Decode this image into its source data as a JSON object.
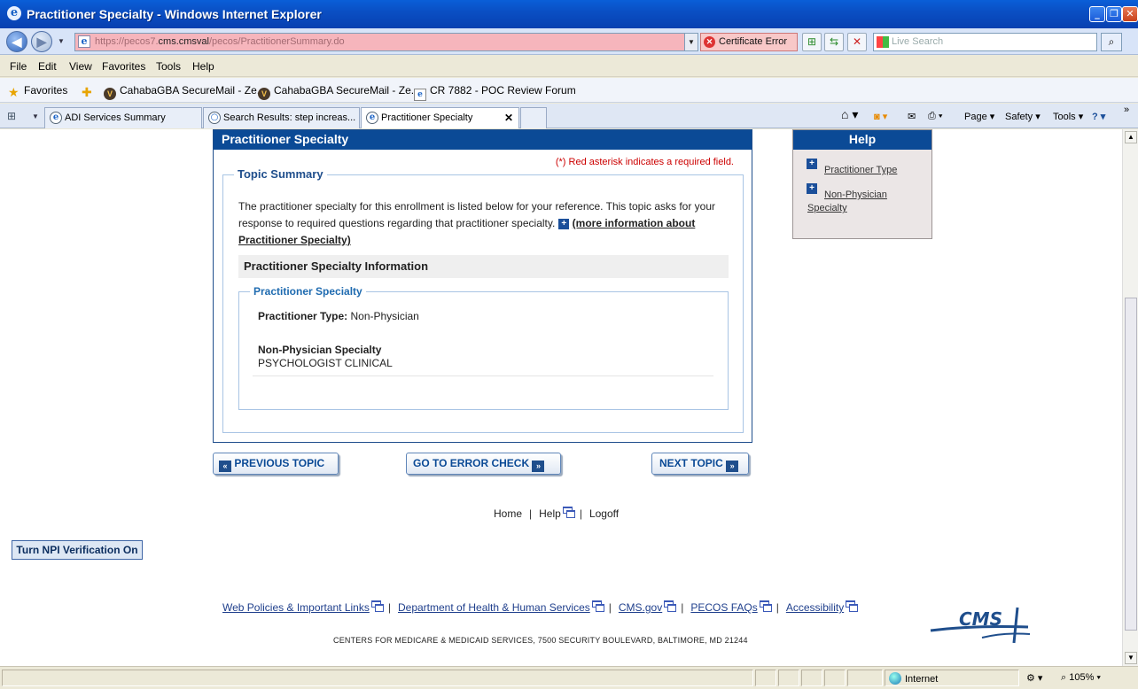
{
  "window": {
    "title": "Practitioner Specialty - Windows Internet Explorer"
  },
  "address_bar": {
    "url_prefix": "https://pecos7.",
    "url_host": "cms.cmsval",
    "url_suffix": "/pecos/PractitionerSummary.do",
    "cert_error": "Certificate Error",
    "search_placeholder": "Live Search"
  },
  "menu": [
    "File",
    "Edit",
    "View",
    "Favorites",
    "Tools",
    "Help"
  ],
  "favorites_bar": {
    "favorites_label": "Favorites",
    "items": [
      "CahabaGBA SecureMail - Ze...",
      "CahabaGBA SecureMail - Ze...",
      "CR 7882 - POC Review Forum"
    ]
  },
  "tabs": [
    {
      "label": "ADI Services Summary"
    },
    {
      "label": "Search Results: step increas..."
    },
    {
      "label": "Practitioner Specialty"
    }
  ],
  "command_bar": {
    "page": "Page",
    "safety": "Safety",
    "tools": "Tools"
  },
  "panel": {
    "title": "Practitioner Specialty",
    "required_note": "(*) Red asterisk indicates a required field.",
    "topic_summary_legend": "Topic Summary",
    "summary_text": "The practitioner specialty for this enrollment is listed below for your reference. This topic asks for your response to required questions regarding that practitioner specialty.",
    "more_info_link": "(more information about Practitioner Specialty)",
    "info_header": "Practitioner Specialty Information",
    "specialty_legend": "Practitioner Specialty",
    "practitioner_type_label": "Practitioner Type:",
    "practitioner_type_value": "Non-Physician",
    "non_physician_label": "Non-Physician Specialty",
    "non_physician_value": "PSYCHOLOGIST CLINICAL"
  },
  "nav_buttons": {
    "previous": "PREVIOUS TOPIC",
    "error_check": "GO TO ERROR CHECK",
    "next": "NEXT TOPIC"
  },
  "utility_links": {
    "home": "Home",
    "help": "Help",
    "logoff": "Logoff"
  },
  "npi_button": "Turn NPI Verification On",
  "footer": {
    "links": [
      "Web Policies & Important Links",
      "Department of Health & Human Services",
      "CMS.gov",
      "PECOS FAQs",
      "Accessibility"
    ],
    "address": "CENTERS FOR MEDICARE & MEDICAID SERVICES, 7500 SECURITY BOULEVARD, BALTIMORE, MD 21244",
    "logo_text": "CMS"
  },
  "help_panel": {
    "title": "Help",
    "link1": "Practitioner Type",
    "link2a": "Non-Physician",
    "link2b": "Specialty"
  },
  "status_bar": {
    "zone": "Internet",
    "zoom": "105%"
  }
}
